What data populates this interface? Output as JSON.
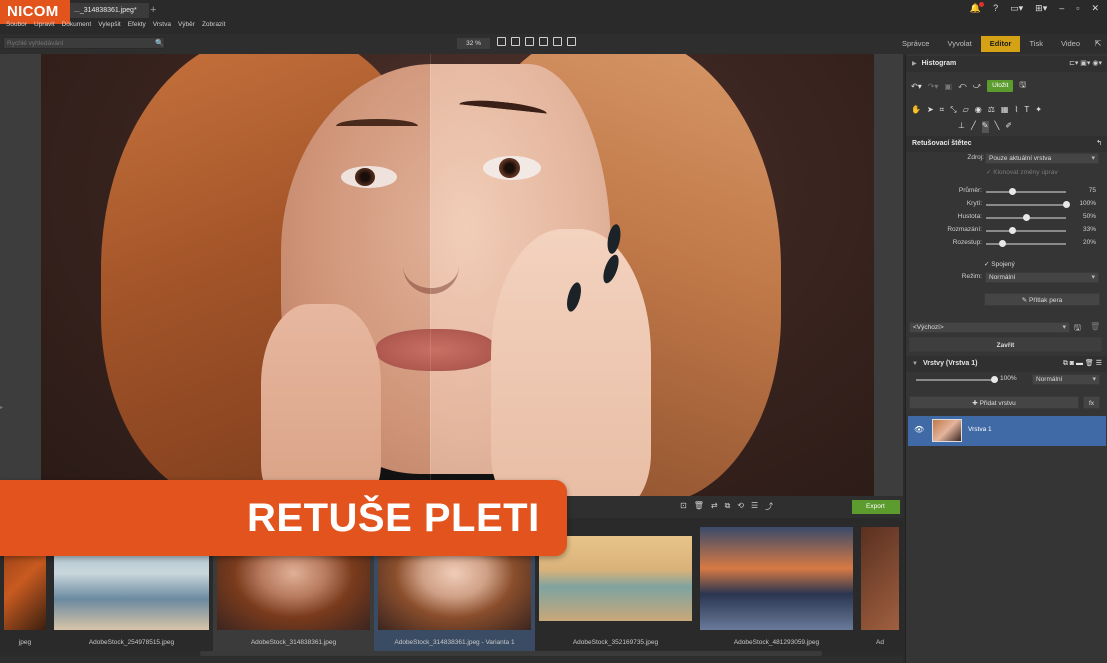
{
  "app": {
    "logo": "NICOM",
    "document_tab": "..._314838361.jpeg*",
    "new_tab": "+",
    "menu": [
      "Soubor",
      "Upravit",
      "Dokument",
      "Vylepšit",
      "Efekty",
      "Vrstva",
      "Výběr",
      "Zobrazit"
    ]
  },
  "toolbar": {
    "search_placeholder": "Rychlé vyhledávání",
    "zoom": "32 %",
    "modes": [
      "Správce",
      "Vyvolat",
      "Editor",
      "Tisk",
      "Video"
    ],
    "active_mode": "Editor"
  },
  "banner": {
    "text": "RETUŠE PLETI"
  },
  "filmstrip": {
    "export_label": "Export",
    "thumbs": [
      {
        "label": "jpeg"
      },
      {
        "label": "AdobeStock_254978515.jpeg"
      },
      {
        "label": "AdobeStock_314838361.jpeg"
      },
      {
        "label": "AdobeStock_314838361.jpeg - Varianta 1"
      },
      {
        "label": "AdobeStock_352169735.jpeg"
      },
      {
        "label": "AdobeStock_481293059.jpeg"
      },
      {
        "label": "Ad"
      }
    ]
  },
  "panel": {
    "histogram_title": "Histogram",
    "save_label": "Uložit",
    "tool_title": "Retušovací štětec",
    "source_label": "Zdroj:",
    "source_value": "Pouze aktuální vrstva",
    "source_option": "Klonovat změny úprav",
    "props": [
      {
        "label": "Průměr:",
        "value": "75",
        "fraction": 0.32
      },
      {
        "label": "Krytí:",
        "value": "100%",
        "fraction": 1.0
      },
      {
        "label": "Hustota:",
        "value": "50%",
        "fraction": 0.5
      },
      {
        "label": "Rozmazání:",
        "value": "33%",
        "fraction": 0.33
      },
      {
        "label": "Rozestup:",
        "value": "20%",
        "fraction": 0.2
      }
    ],
    "connected_label": "Spojený",
    "mode_label": "Režim:",
    "mode_value": "Normální",
    "pen_pressure": "Přítlak pera",
    "preset_value": "<Výchozí>",
    "close_label": "Zavřít",
    "layers_title": "Vrstvy (Vrstva 1)",
    "layer_opacity": "100%",
    "layer_mode": "Normální",
    "add_layer": "Přidat vrstvu",
    "fx": "fx",
    "layer_name": "Vrstva 1"
  },
  "colors": {
    "accent_orange": "#e2531d",
    "active_mode": "#d4a214",
    "green": "#5c9b2e",
    "layer_selected": "#3f6aa5"
  }
}
